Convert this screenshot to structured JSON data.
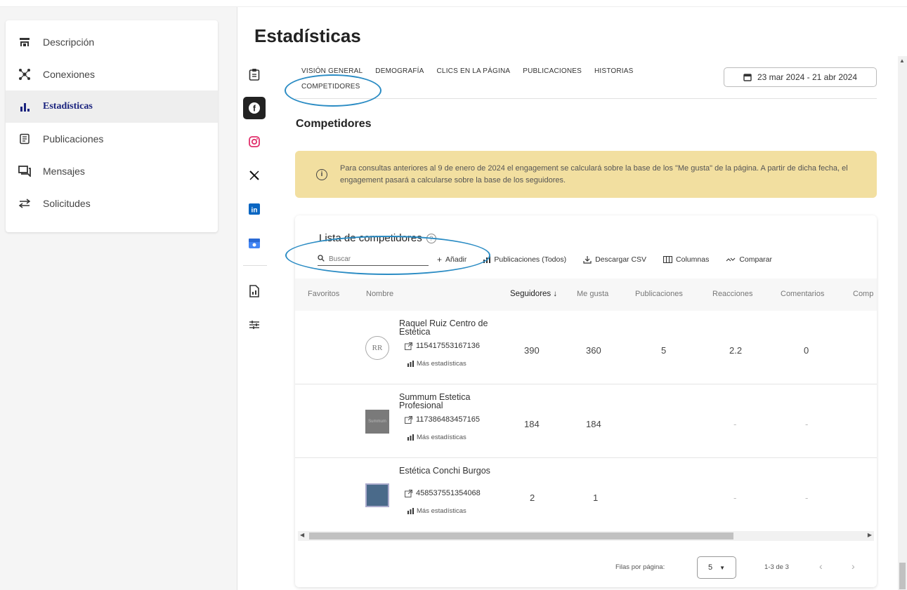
{
  "sidebar": {
    "items": [
      {
        "label": "Descripción",
        "icon": "store-icon",
        "glyph": "⊟"
      },
      {
        "label": "Conexiones",
        "icon": "network-icon",
        "glyph": "✲"
      },
      {
        "label": "Estadísticas",
        "icon": "bar-chart-icon",
        "glyph": "▮",
        "active": true
      },
      {
        "label": "Publicaciones",
        "icon": "document-icon",
        "glyph": "▤"
      },
      {
        "label": "Mensajes",
        "icon": "chat-icon",
        "glyph": "⊡"
      },
      {
        "label": "Solicitudes",
        "icon": "swap-icon",
        "glyph": "⇄"
      }
    ]
  },
  "page": {
    "title": "Estadísticas"
  },
  "networks": {
    "clipboard": "▤",
    "facebook": "f",
    "instagram": "◎",
    "x": "𝕏",
    "linkedin": "in",
    "gmb": "▦",
    "report": "▥",
    "settings": "☷"
  },
  "tabs": [
    "VISIÓN GENERAL",
    "DEMOGRAFÍA",
    "CLICS EN LA PÁGINA",
    "PUBLICACIONES",
    "HISTORIAS",
    "COMPETIDORES"
  ],
  "date_range": "23 mar 2024 - 21 abr 2024",
  "section_title": "Competidores",
  "alert": {
    "text": "Para consultas anteriores al 9 de enero de 2024 el engagement se calculará sobre la base de los \"Me gusta\" de la página. A partir de dicha fecha, el engagement pasará a calcularse sobre la base de los seguidores."
  },
  "competitors": {
    "title": "Lista de competidores",
    "search_placeholder": "Buscar",
    "toolbar": {
      "add": "Añadir",
      "posts": "Publicaciones (Todos)",
      "csv": "Descargar CSV",
      "columns": "Columnas",
      "compare": "Comparar"
    },
    "columns": [
      "Favoritos",
      "Nombre",
      "Seguidores ↓",
      "Me gusta",
      "Publicaciones",
      "Reacciones",
      "Comentarios",
      "Comp"
    ],
    "more_stats": "Más estadísticas",
    "rows": [
      {
        "name": "Raquel Ruiz Centro de Estética",
        "id": "115417553167136",
        "seguidores": "390",
        "me_gusta": "360",
        "publicaciones": "5",
        "reacciones": "2.2",
        "comentarios": "0",
        "avatar_text": "RR"
      },
      {
        "name": "Summum Estetica Profesional",
        "id": "117386483457165",
        "seguidores": "184",
        "me_gusta": "184",
        "publicaciones": "",
        "reacciones": "-",
        "comentarios": "-",
        "avatar_text": "Summum"
      },
      {
        "name": "Estética Conchi Burgos",
        "id": "458537551354068",
        "seguidores": "2",
        "me_gusta": "1",
        "publicaciones": "",
        "reacciones": "-",
        "comentarios": "-",
        "avatar_text": ""
      }
    ],
    "pager": {
      "rows_label": "Filas por página:",
      "rows_value": "5",
      "range": "1-3 de 3"
    }
  },
  "colors": {
    "accent": "#1a237e",
    "alert_bg": "#f2dfa0",
    "annotation": "#2b8cc4"
  }
}
